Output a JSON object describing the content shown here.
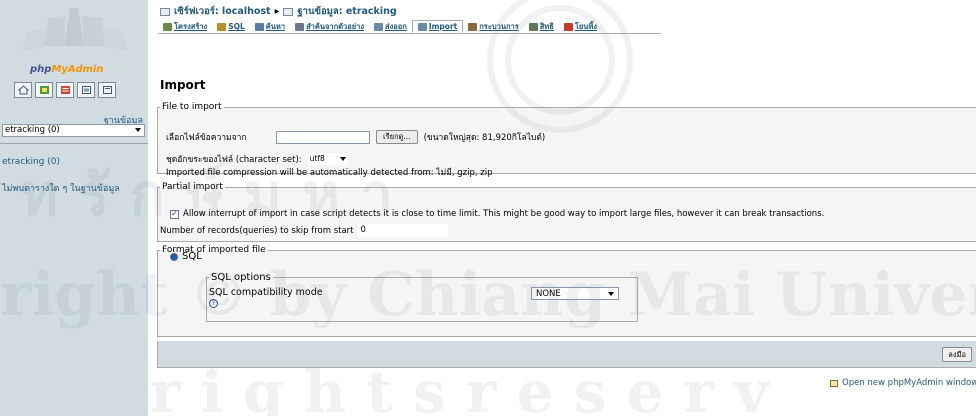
{
  "sidebar": {
    "logo": {
      "php": "php",
      "my": "My",
      "admin": "Admin"
    },
    "icons": [
      "home-icon",
      "sql-query-icon",
      "sql-docs-icon",
      "docs-icon",
      "reload-icon"
    ],
    "db_label": "ฐานข้อมูล",
    "db_select_value": "etracking (0)",
    "db_link": "etracking (0)",
    "no_table_text": "ไม่พบตารางใด ๆ ในฐานข้อมูล"
  },
  "breadcrumb": {
    "server": "เซิร์ฟเวอร์: localhost",
    "separator": "▸",
    "database": "ฐานข้อมูล: etracking"
  },
  "tabs": [
    {
      "label": "โครงสร้าง",
      "icon": "structure-icon",
      "color": "#6a8a4a"
    },
    {
      "label": "SQL",
      "icon": "sql-icon",
      "color": "#b8902a"
    },
    {
      "label": "ค้นหา",
      "icon": "search-icon",
      "color": "#5a7aa8"
    },
    {
      "label": "สำค้นจากตัวอย่าง",
      "icon": "query-icon",
      "color": "#6a7a8a"
    },
    {
      "label": "ส่งออก",
      "icon": "export-icon",
      "color": "#6a8aa8"
    },
    {
      "label": "Import",
      "icon": "import-icon",
      "color": "#6a8aa8",
      "active": true
    },
    {
      "label": "กระบวนการ",
      "icon": "operations-icon",
      "color": "#8a6a3a"
    },
    {
      "label": "สิทธิ",
      "icon": "privileges-icon",
      "color": "#5a7a5a"
    },
    {
      "label": "โยนทิ้ง",
      "icon": "drop-icon",
      "color": "#c83a2a"
    }
  ],
  "page_title": "Import",
  "file_to_import": {
    "legend": "File to import",
    "browse_label": "เลือกไฟล์ข้อความจาก",
    "browse_button": "เรียกดู...",
    "max_size": "(ขนาดใหญ่สุด: 81,920กิโลไบต์)",
    "charset_label": "ชุดอักขระของไฟล์ (character set):",
    "charset_value": "utf8",
    "compression_note": "Imported file compression will be automatically detected from: ไม่มี, gzip, zip"
  },
  "partial_import": {
    "legend": "Partial import",
    "allow_interrupt_text": "Allow interrupt of import in case script detects it is close to time limit. This might be good way to import large files, however it can break transactions.",
    "allow_interrupt_checked": true,
    "skip_label": "Number of records(queries) to skip from start",
    "skip_value": "0"
  },
  "format": {
    "legend": "Format of imported file",
    "sql_radio_label": "SQL",
    "sql_options_legend": "SQL options",
    "compat_label": "SQL compatibility mode",
    "compat_value": "NONE",
    "help_glyph": "?"
  },
  "go_button": "ลงมือ",
  "open_new_window": "Open new phpMyAdmin window",
  "colors": {
    "sidebar_bg": "#d0dce0",
    "link": "#235a81",
    "fieldset_bg": "#f5f5f5"
  }
}
